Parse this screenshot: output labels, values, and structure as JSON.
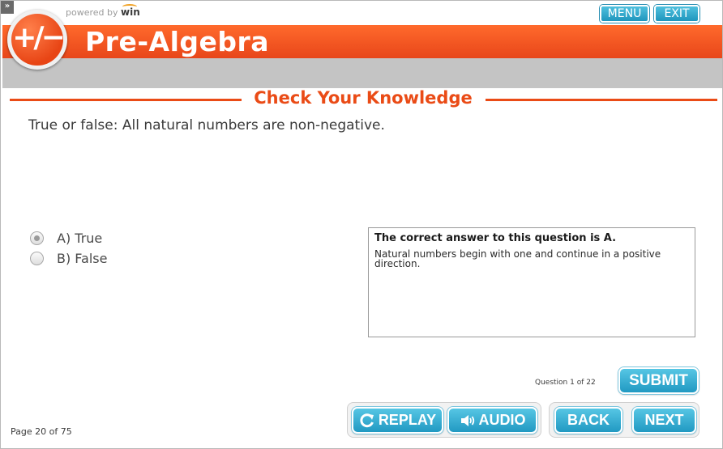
{
  "app": {
    "powered_by": "powered by",
    "powered_brand": "win",
    "title": "Pre-Algebra",
    "logo_glyph": "+/−"
  },
  "nav": {
    "menu_label": "MENU",
    "exit_label": "EXIT"
  },
  "section": {
    "title": "Check Your Knowledge"
  },
  "question": {
    "text": "True or false: All natural numbers are non-negative.",
    "options": [
      {
        "label": "A) True",
        "selected": true
      },
      {
        "label": "B) False",
        "selected": false
      }
    ]
  },
  "feedback": {
    "heading": "The correct answer to this question is A.",
    "body": "Natural numbers begin with one and continue in a positive direction."
  },
  "progress": {
    "question_counter": "Question 1 of 22",
    "page_counter": "Page 20 of 75"
  },
  "controls": {
    "submit_label": "SUBMIT",
    "replay_label": "REPLAY",
    "audio_label": "AUDIO",
    "back_label": "BACK",
    "next_label": "NEXT"
  },
  "icons": {
    "expand": "expand-icon",
    "replay": "replay-icon",
    "audio": "speaker-icon"
  },
  "colors": {
    "accent_orange": "#ea4b16",
    "button_blue": "#2199c2",
    "header_gray": "#c4c4c4"
  }
}
